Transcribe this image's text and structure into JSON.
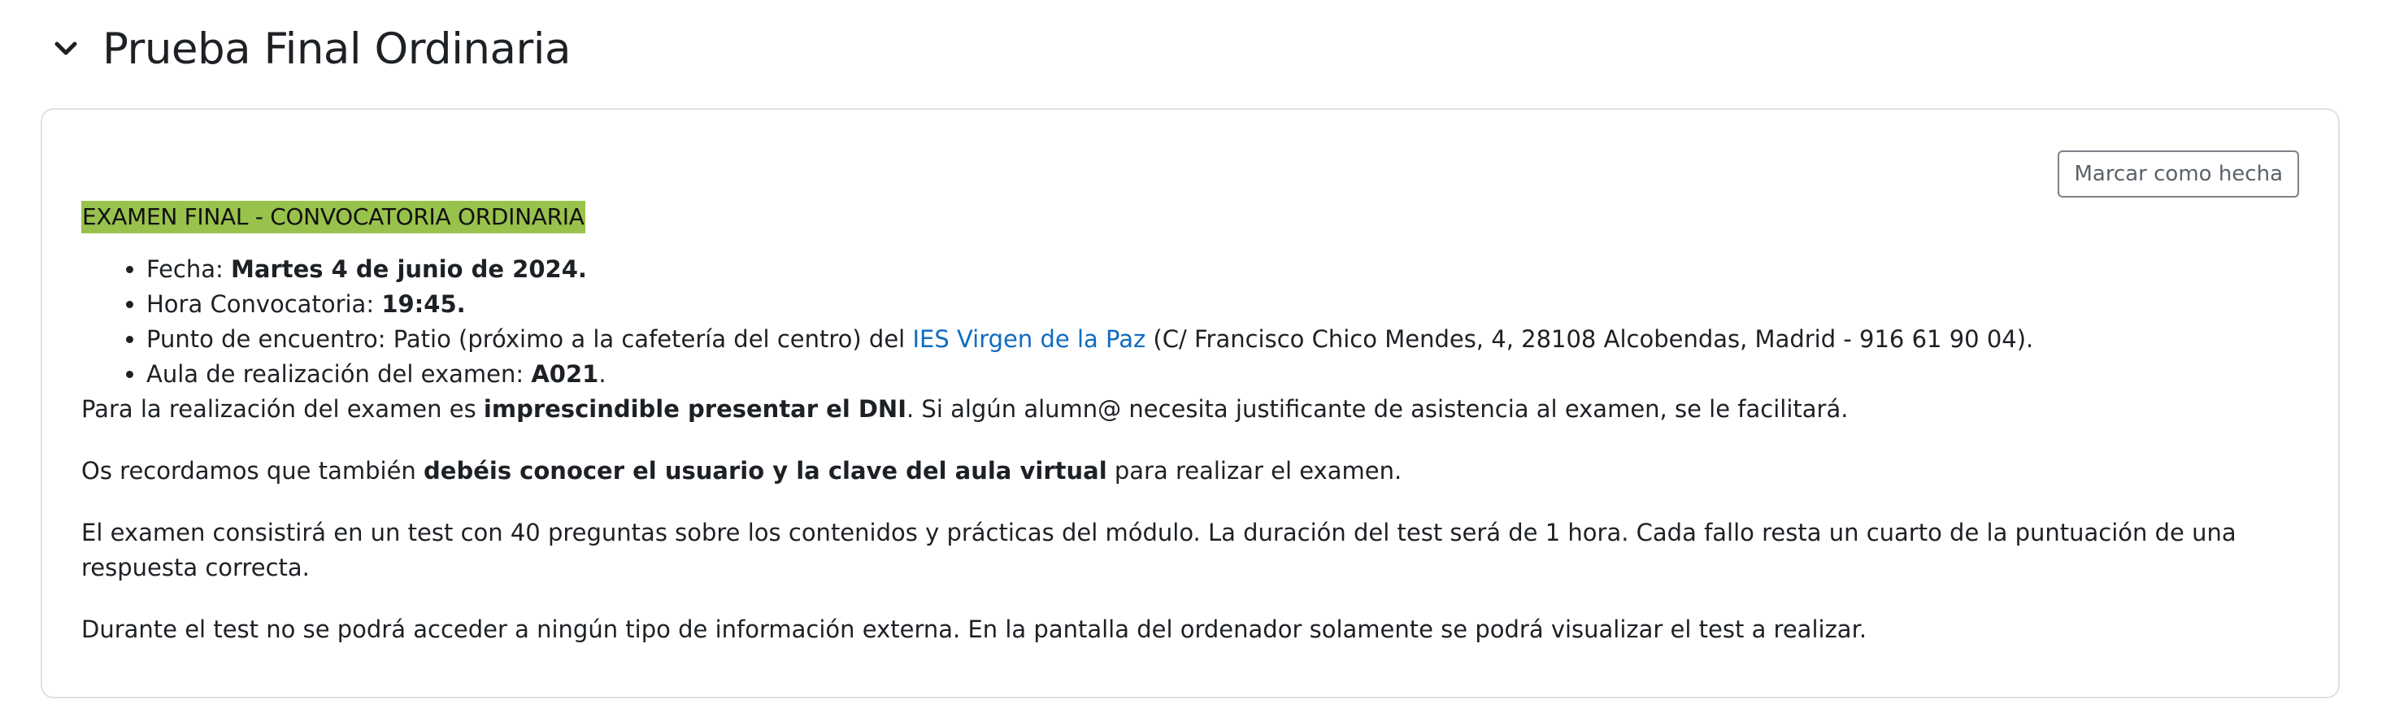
{
  "section": {
    "title": "Prueba Final Ordinaria"
  },
  "card": {
    "mark_done_label": "Marcar como hecha",
    "heading": "EXAMEN FINAL - CONVOCATORIA ORDINARIA",
    "details": {
      "fecha_label": "Fecha: ",
      "fecha_value": "Martes 4 de junio de 2024.",
      "hora_label": "Hora Convocatoria: ",
      "hora_value": "19:45.",
      "punto_label": "Punto de encuentro: Patio (próximo a la cafetería del centro) del ",
      "punto_link": "IES Virgen de la Paz",
      "punto_rest": " (C/ Francisco Chico Mendes, 4, 28108 Alcobendas, Madrid - 916 61 90 04).",
      "aula_label": "Aula de realización del examen: ",
      "aula_value": "A021",
      "aula_end": "."
    },
    "p1": {
      "before": "Para la realización del examen es ",
      "bold": "imprescindible presentar el DNI",
      "after": ". Si algún alumn@ necesita justificante de asistencia al examen, se le facilitará."
    },
    "p2": {
      "before": "Os recordamos que también ",
      "bold": "debéis conocer el usuario y la clave del aula virtual",
      "after": " para realizar el examen."
    },
    "p3": "El examen consistirá en un test con 40 preguntas sobre los contenidos y prácticas del módulo. La duración del test será de 1 hora. Cada fallo resta un cuarto de la puntuación de una respuesta correcta.",
    "p4": "Durante el test no se podrá acceder a ningún tipo de información externa. En la pantalla del ordenador solamente se podrá visualizar el test a realizar."
  },
  "colors": {
    "highlight": "#99c24d",
    "link": "#0f6cbf",
    "text": "#1d2125",
    "border": "#dee2e6"
  },
  "icons": {
    "collapse": "chevron-down-icon"
  }
}
